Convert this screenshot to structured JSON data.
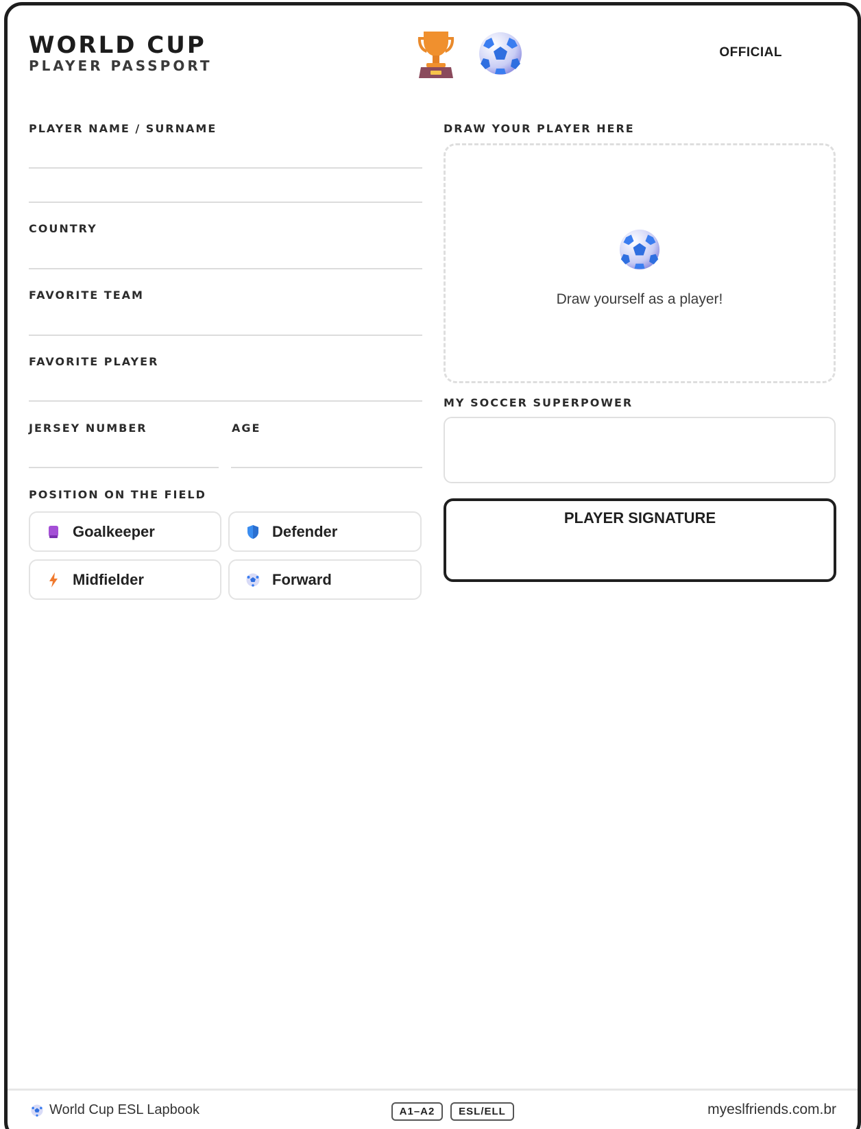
{
  "header": {
    "title": "WORLD CUP",
    "subtitle": "PLAYER PASSPORT",
    "stamp": "OFFICIAL",
    "icons": [
      "trophy-icon",
      "soccer-ball-icon"
    ]
  },
  "fields": {
    "player_name": "PLAYER NAME / SURNAME",
    "country": "COUNTRY",
    "favorite_team": "FAVORITE TEAM",
    "favorite_player": "FAVORITE PLAYER",
    "jersey_number": "JERSEY NUMBER",
    "age": "AGE"
  },
  "position": {
    "label": "POSITION ON THE FIELD",
    "options": [
      {
        "label": "Goalkeeper",
        "icon": "glove-icon"
      },
      {
        "label": "Defender",
        "icon": "shield-icon"
      },
      {
        "label": "Midfielder",
        "icon": "lightning-icon"
      },
      {
        "label": "Forward",
        "icon": "soccer-ball-icon"
      }
    ]
  },
  "draw": {
    "label": "DRAW YOUR PLAYER HERE",
    "hint": "Draw yourself as a player!"
  },
  "superpower": {
    "label": "MY SOCCER SUPERPOWER"
  },
  "signature": {
    "label": "PLAYER SIGNATURE"
  },
  "footer": {
    "left": "World Cup ESL Lapbook",
    "badges": [
      "A1–A2",
      "ESL/ELL"
    ],
    "right": "myeslfriends.com.br"
  },
  "colors": {
    "ink": "#1e1e1e",
    "trophy": "#f0902e",
    "trophy_base": "#8a4a5c",
    "ball_blue": "#2f6fe0",
    "glove": "#a44fd6",
    "shield": "#3a8df0",
    "lightning": "#f07a2e"
  }
}
